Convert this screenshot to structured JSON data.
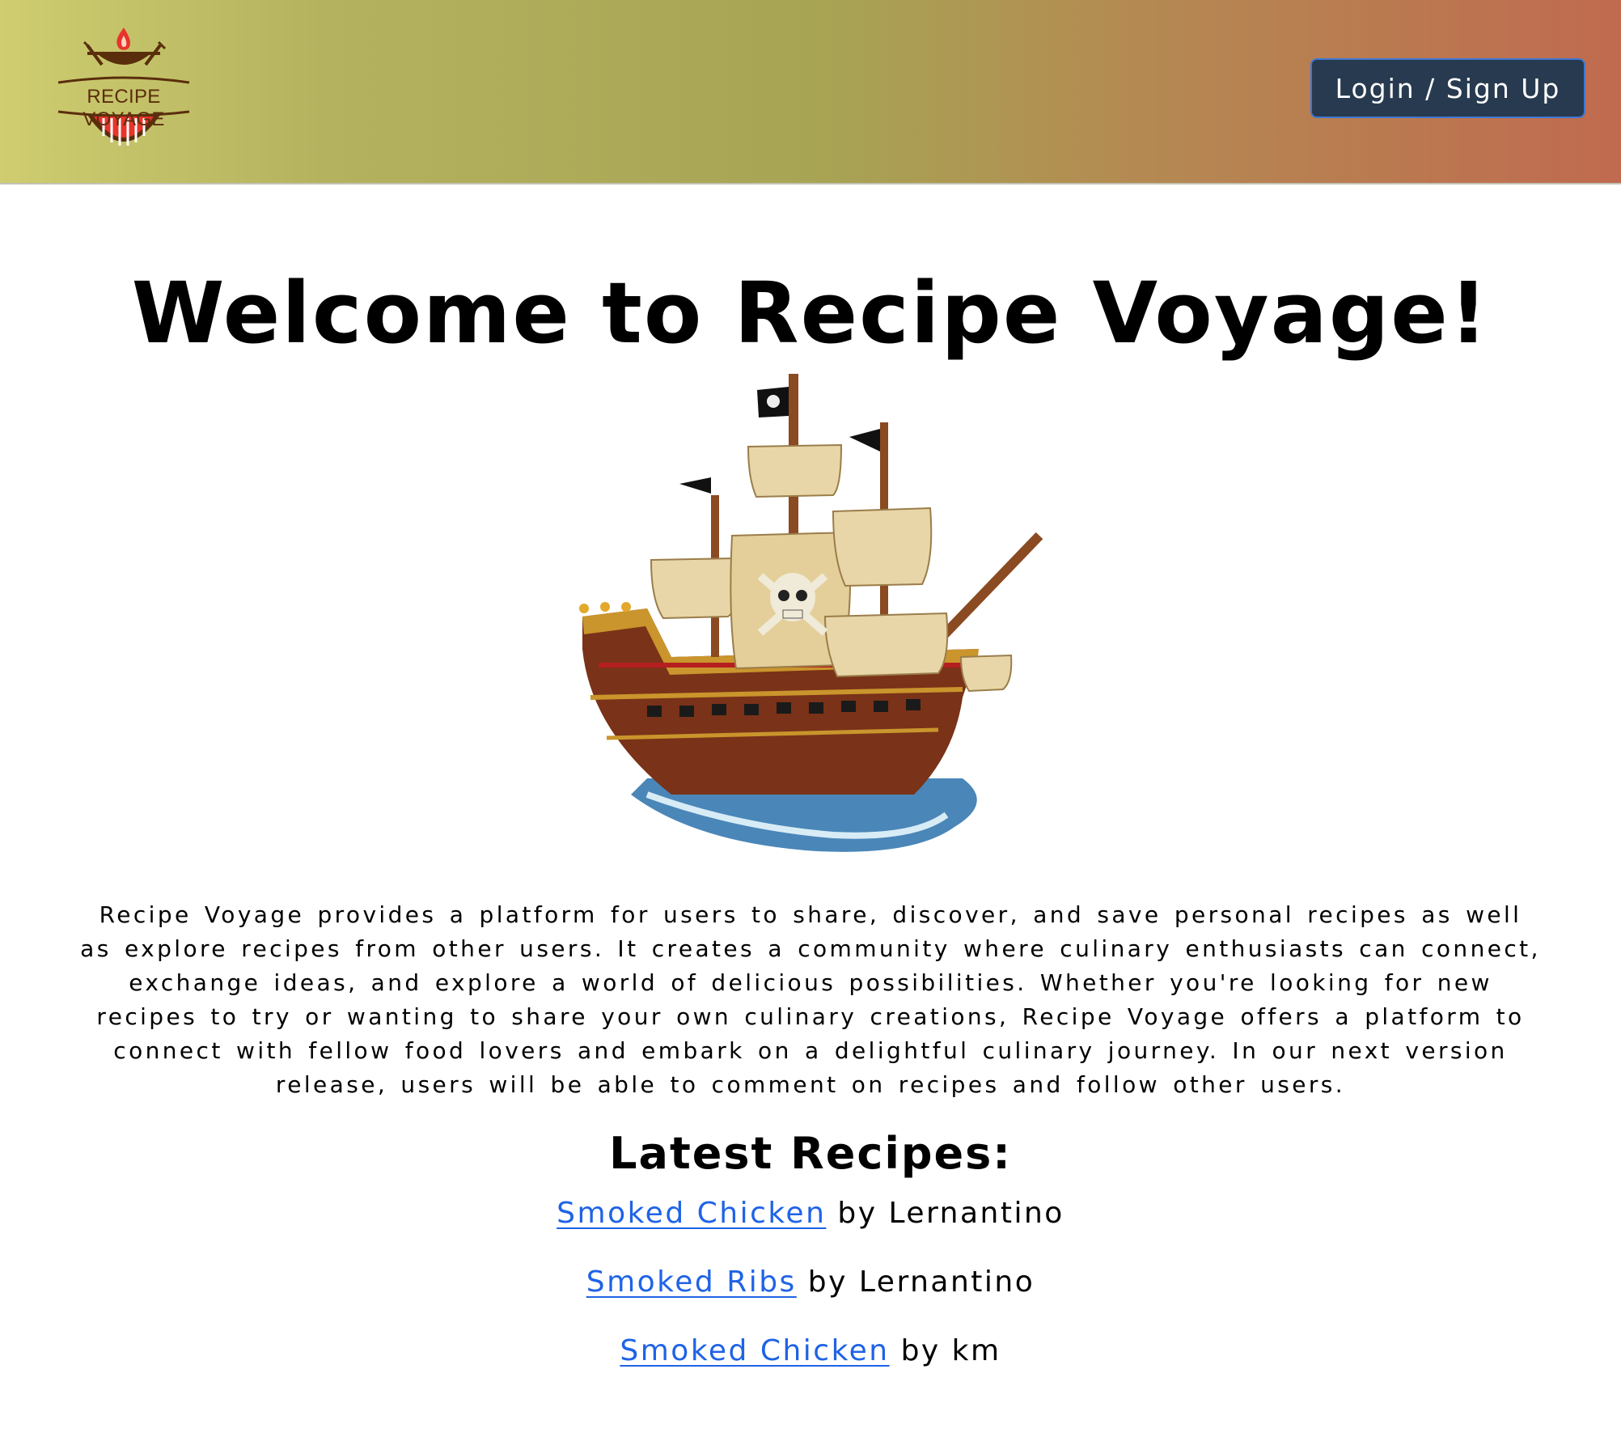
{
  "header": {
    "logo_text": "RECIPE VOYAGE",
    "login_label": "Login / Sign Up"
  },
  "main": {
    "title": "Welcome to Recipe Voyage!",
    "description": "Recipe Voyage provides a platform for users to share, discover, and save personal recipes as well as explore recipes from other users. It creates a community where culinary enthusiasts can connect, exchange ideas, and explore a world of delicious possibilities. Whether you're looking for new recipes to try or wanting to share your own culinary creations, Recipe Voyage offers a platform to connect with fellow food lovers and embark on a delightful culinary journey. In our next version release, users will be able to comment on recipes and follow other users.",
    "latest_heading": "Latest Recipes:",
    "recipes": [
      {
        "title": "Smoked Chicken",
        "author_text": "by Lernantino"
      },
      {
        "title": "Smoked Ribs",
        "author_text": "by Lernantino"
      },
      {
        "title": "Smoked Chicken",
        "author_text": "by km"
      }
    ]
  },
  "colors": {
    "link": "#1f63e6",
    "button_bg": "#273a4f",
    "button_border": "#3f78d2"
  }
}
